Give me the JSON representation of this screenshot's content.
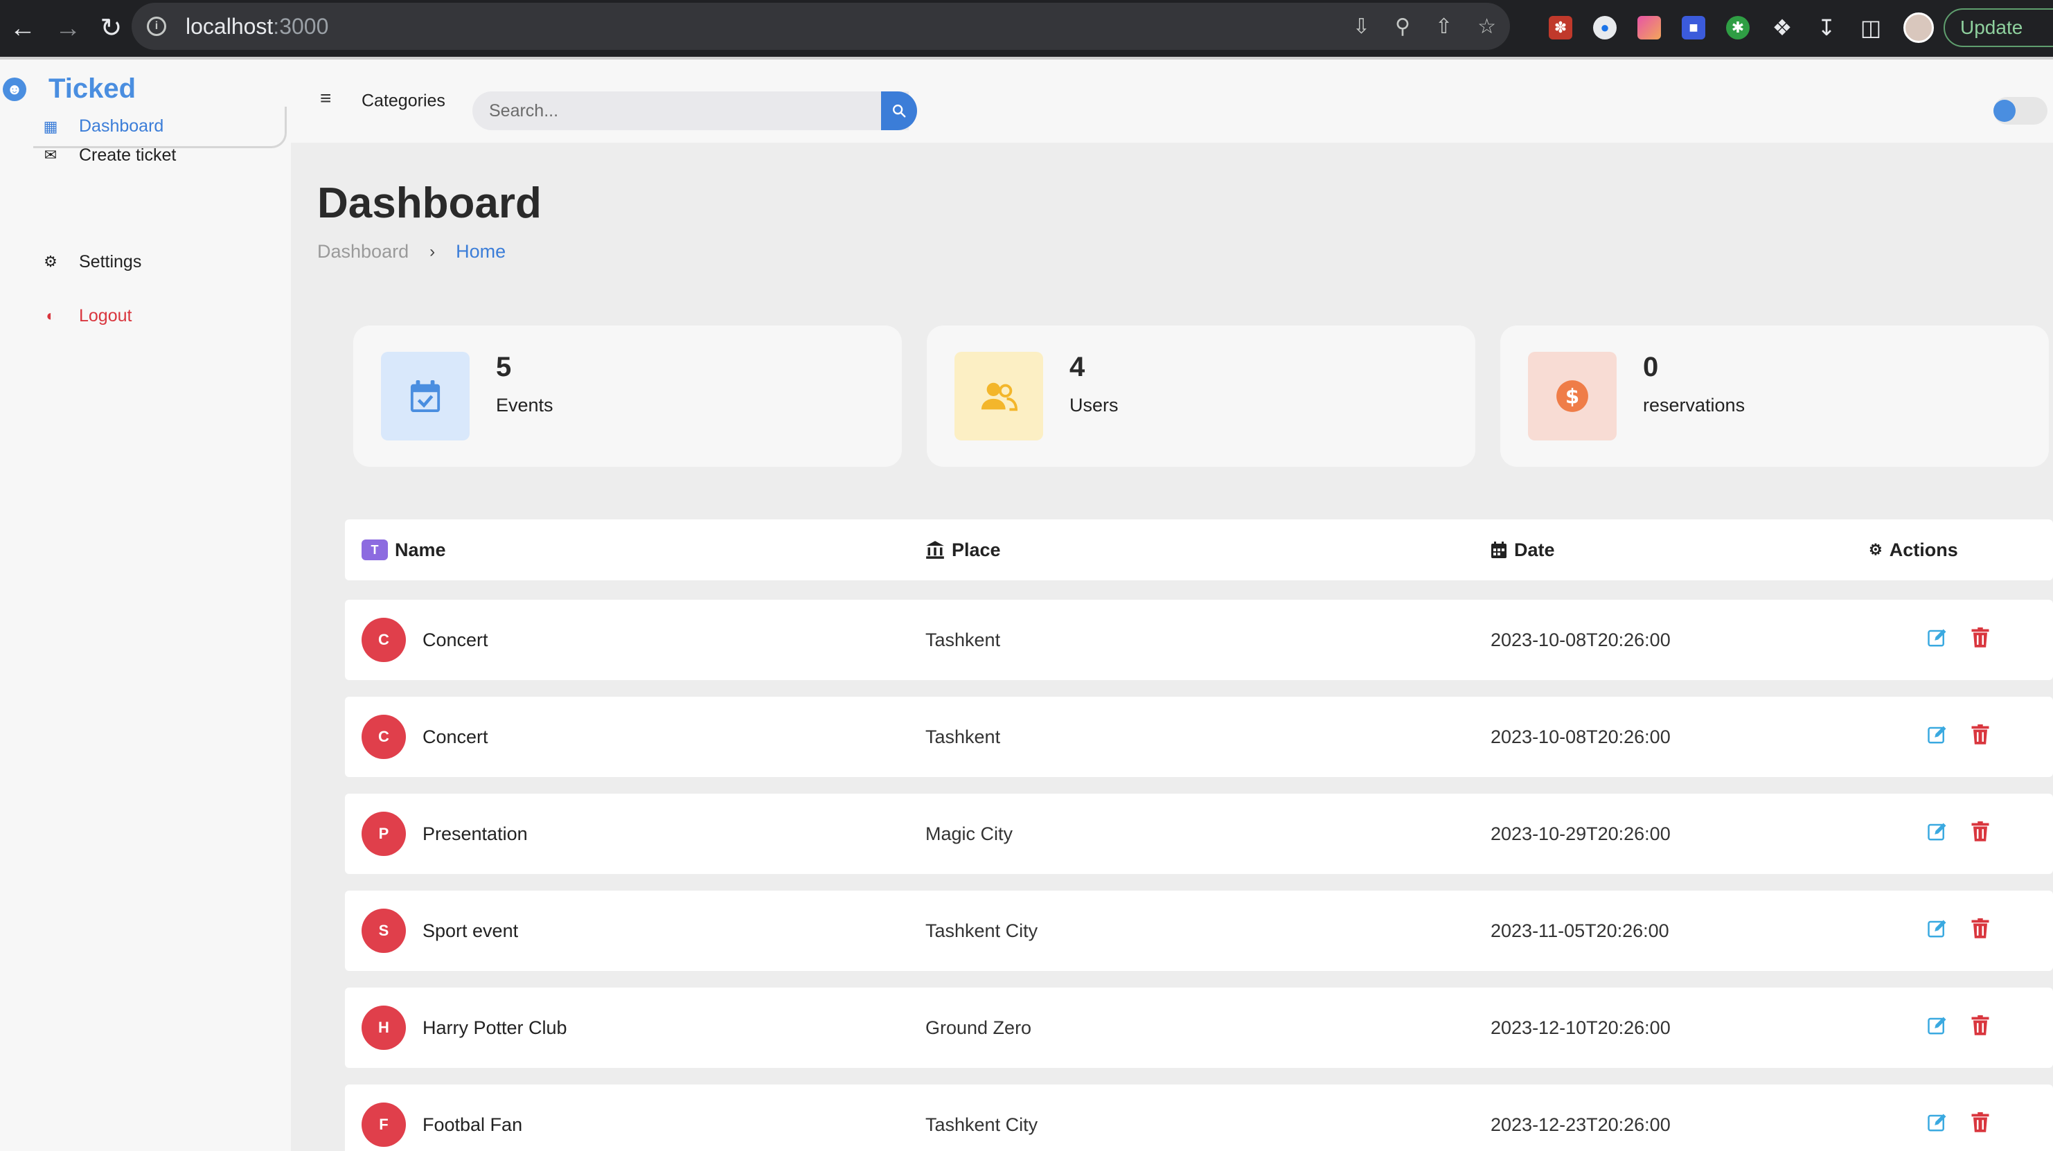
{
  "browser": {
    "url_host": "localhost",
    "url_port": ":3000",
    "update_label": "Update"
  },
  "brand": {
    "name": "Ticked"
  },
  "sidebar": {
    "items": [
      {
        "label": "Dashboard",
        "icon": "grid-icon",
        "active": true
      },
      {
        "label": "Create ticket",
        "icon": "envelope-icon"
      },
      {
        "label": "Settings",
        "icon": "gear-icon"
      },
      {
        "label": "Logout",
        "icon": "logout-icon"
      }
    ]
  },
  "topbar": {
    "categories_label": "Categories",
    "search_placeholder": "Search..."
  },
  "page": {
    "title": "Dashboard",
    "breadcrumb": [
      "Dashboard",
      "Home"
    ]
  },
  "stats": [
    {
      "value": "5",
      "label": "Events",
      "icon": "calendar-check-icon",
      "bg": "#d9e8fb",
      "color": "#4a8ee0"
    },
    {
      "value": "4",
      "label": "Users",
      "icon": "users-icon",
      "bg": "#fcefc4",
      "color": "#f3b62b"
    },
    {
      "value": "0",
      "label": "reservations",
      "icon": "dollar-icon",
      "bg": "#f8dcd4",
      "color": "#ef7d48"
    }
  ],
  "table": {
    "headers": {
      "name": "Name",
      "place": "Place",
      "date": "Date",
      "actions": "Actions",
      "name_badge": "T"
    },
    "rows": [
      {
        "initial": "C",
        "name": "Concert",
        "place": "Tashkent",
        "date": "2023-10-08T20:26:00"
      },
      {
        "initial": "C",
        "name": "Concert",
        "place": "Tashkent",
        "date": "2023-10-08T20:26:00"
      },
      {
        "initial": "P",
        "name": "Presentation",
        "place": "Magic City",
        "date": "2023-10-29T20:26:00"
      },
      {
        "initial": "S",
        "name": "Sport event",
        "place": "Tashkent City",
        "date": "2023-11-05T20:26:00"
      },
      {
        "initial": "H",
        "name": "Harry Potter Club",
        "place": "Ground Zero",
        "date": "2023-12-10T20:26:00"
      },
      {
        "initial": "F",
        "name": "Footbal Fan",
        "place": "Tashkent City",
        "date": "2023-12-23T20:26:00"
      }
    ]
  },
  "colors": {
    "accent": "#3b7dd8",
    "danger": "#d9363e",
    "avatar": "#e03f4b",
    "edit": "#3aa9e0"
  }
}
